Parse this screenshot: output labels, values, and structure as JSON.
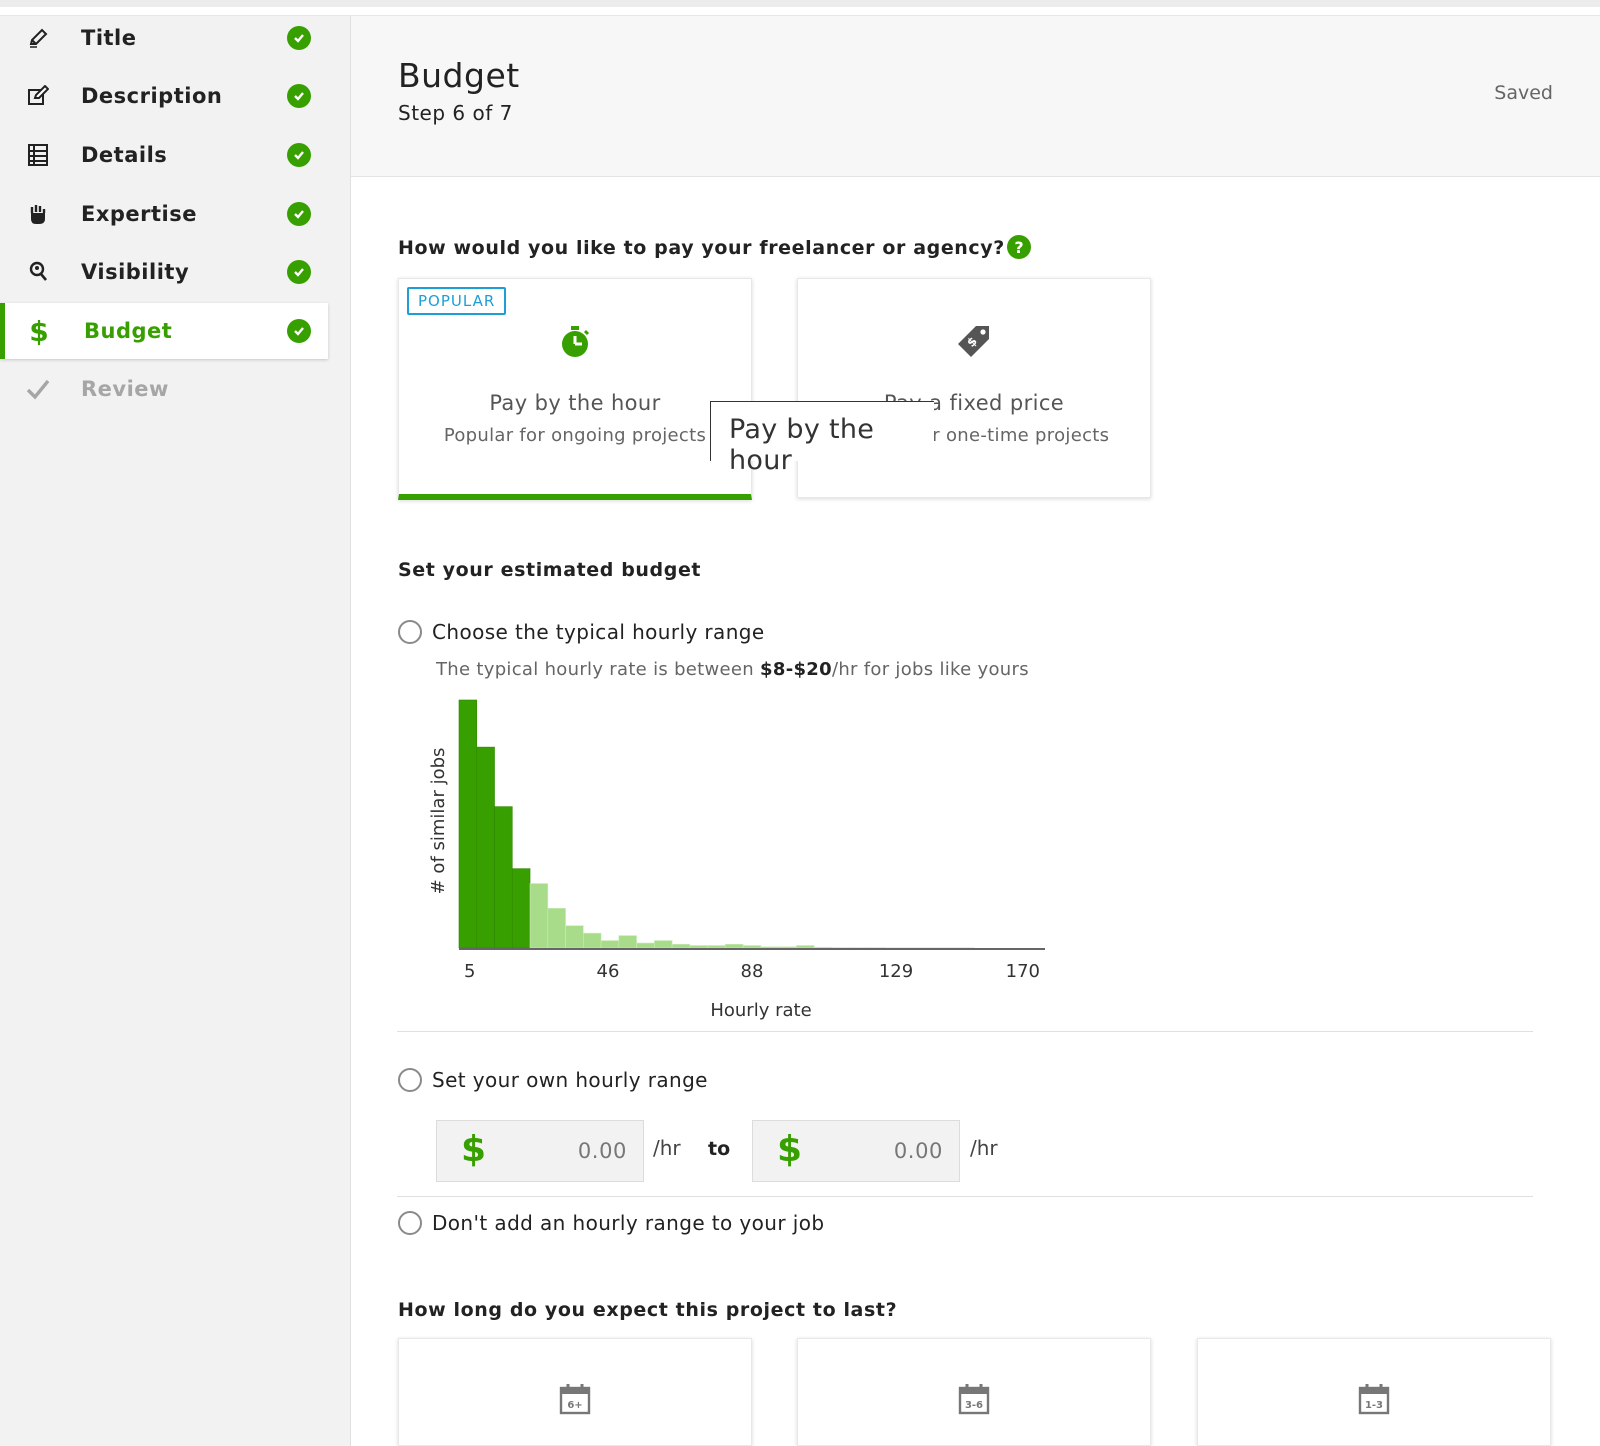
{
  "sidebar": {
    "items": [
      {
        "label": "Title",
        "icon": "pencil-icon",
        "done": true
      },
      {
        "label": "Description",
        "icon": "edit-icon",
        "done": true
      },
      {
        "label": "Details",
        "icon": "list-icon",
        "done": true
      },
      {
        "label": "Expertise",
        "icon": "hand-icon",
        "done": true
      },
      {
        "label": "Visibility",
        "icon": "person-search-icon",
        "done": true
      },
      {
        "label": "Budget",
        "icon": "dollar-icon",
        "done": true,
        "active": true
      },
      {
        "label": "Review",
        "icon": "checkmark-icon",
        "done": false,
        "disabled": true
      }
    ]
  },
  "header": {
    "title": "Budget",
    "step": "Step 6 of 7",
    "status": "Saved"
  },
  "payment": {
    "question": "How would you like to pay your freelancer or agency?",
    "help_icon": "?",
    "hourly": {
      "badge": "POPULAR",
      "title": "Pay by the hour",
      "subtitle": "Popular for ongoing projects",
      "icon": "stopwatch-icon",
      "selected": true
    },
    "fixed": {
      "title": "Pay a fixed price",
      "subtitle": "Popular for one-time projects",
      "icon": "price-tag-icon",
      "selected": false
    },
    "tooltip": "Pay by the hour"
  },
  "budget": {
    "heading": "Set your estimated budget",
    "option_typical": "Choose the typical hourly range",
    "hint_prefix": "The typical hourly rate is between ",
    "hint_range": "$8-$20",
    "hint_suffix": "/hr for jobs like yours",
    "option_own": "Set your own hourly range",
    "currency": "$",
    "from_value": "0.00",
    "to_value": "0.00",
    "per_hour": "/hr",
    "to_label": "to",
    "option_none": "Don't add an hourly range to your job"
  },
  "duration": {
    "question": "How long do you expect this project to last?",
    "cards": [
      {
        "label": "6+",
        "icon": "calendar-icon"
      },
      {
        "label": "3-6",
        "icon": "calendar-icon"
      },
      {
        "label": "1-3",
        "icon": "calendar-icon"
      }
    ]
  },
  "colors": {
    "accent": "#37a000",
    "histogram_highlight": "#37a000",
    "histogram_other": "#a8dc8a",
    "badge_blue": "#1d9fd6"
  },
  "chart_data": {
    "type": "bar",
    "ylabel": "# of similar jobs",
    "xlabel": "Hourly rate",
    "xticks": [
      "5",
      "46",
      "88",
      "129",
      "170"
    ],
    "xlim": [
      5,
      170
    ],
    "bin_width": 5,
    "bins_start": [
      5,
      10,
      15,
      20,
      25,
      30,
      35,
      40,
      45,
      50,
      55,
      60,
      65,
      70,
      75,
      80,
      85,
      90,
      95,
      100,
      105,
      110,
      115,
      120,
      125,
      130,
      135,
      140,
      145,
      150,
      155,
      160,
      165
    ],
    "values": [
      100,
      81,
      57,
      32,
      26,
      16,
      9,
      6,
      3,
      5,
      2,
      3,
      1.5,
      1,
      1,
      1.5,
      1,
      0.5,
      0.5,
      1,
      0.3,
      0.2,
      0.2,
      0.2,
      0.1,
      0.1,
      0.1,
      0.1,
      0.1,
      0,
      0,
      0,
      0
    ],
    "highlight_range": [
      5,
      25
    ]
  }
}
